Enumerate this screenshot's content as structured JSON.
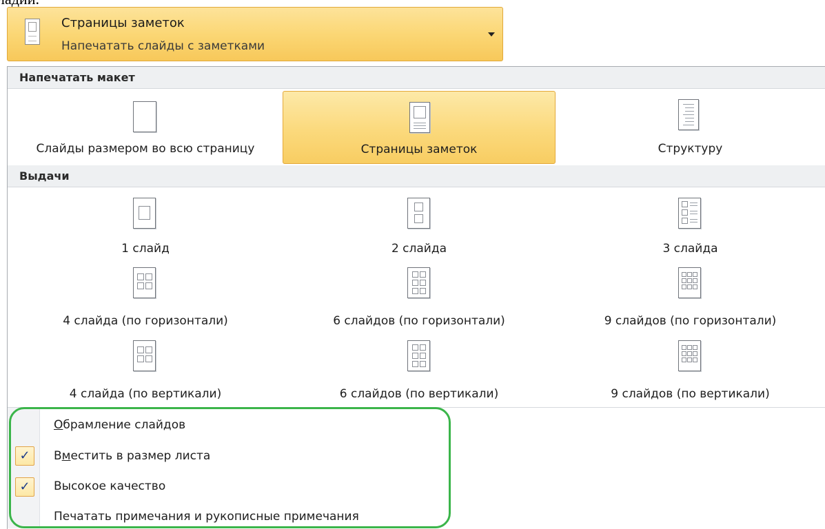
{
  "cropped_text": "ладии.",
  "dropdown": {
    "title": "Страницы заметок",
    "subtitle": "Напечатать слайды с заметками",
    "icon": "notes-page-icon",
    "arrow_icon": "chevron-down-icon"
  },
  "print_layout": {
    "header": "Напечатать макет",
    "items": [
      {
        "label": "Слайды размером во всю страницу",
        "icon": "full-page-slide-icon"
      },
      {
        "label": "Страницы заметок",
        "icon": "notes-page-icon",
        "selected": true
      },
      {
        "label": "Структуру",
        "icon": "outline-icon"
      }
    ]
  },
  "handouts": {
    "header": "Выдачи",
    "items": [
      {
        "label": "1 слайд",
        "icon": "one-slide-icon"
      },
      {
        "label": "2 слайда",
        "icon": "two-slides-icon"
      },
      {
        "label": "3 слайда",
        "icon": "three-slides-icon"
      },
      {
        "label": "4 слайда (по горизонтали)",
        "icon": "four-slides-horizontal-icon"
      },
      {
        "label": "6 слайдов (по горизонтали)",
        "icon": "six-slides-horizontal-icon"
      },
      {
        "label": "9 слайдов (по горизонтали)",
        "icon": "nine-slides-horizontal-icon"
      },
      {
        "label": "4 слайда (по вертикали)",
        "icon": "four-slides-vertical-icon"
      },
      {
        "label": "6 слайдов (по вертикали)",
        "icon": "six-slides-vertical-icon"
      },
      {
        "label": "9 слайдов (по вертикали)",
        "icon": "nine-slides-vertical-icon"
      }
    ]
  },
  "options": [
    {
      "label_accel": "О",
      "label_rest": "брамление слайдов",
      "checked": false
    },
    {
      "label_pre": "В",
      "label_accel": "м",
      "label_rest": "естить в размер листа",
      "checked": true
    },
    {
      "label": "Высокое качество",
      "checked": true
    },
    {
      "label": "Печатать примечания и рукописные примечания",
      "checked": false
    }
  ],
  "check_glyph": "✓",
  "colors": {
    "selected_fill": "#fbd97c",
    "selected_border": "#e4a93a",
    "highlight_outline": "#3bb54a",
    "section_header_bg": "#eef0f2"
  }
}
